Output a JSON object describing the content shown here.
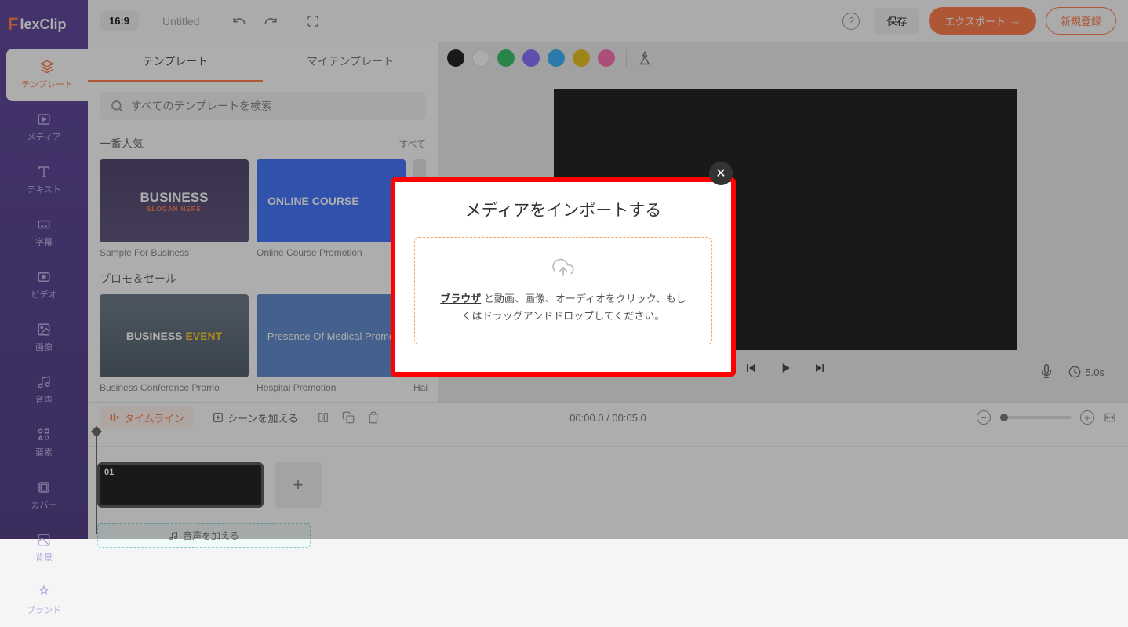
{
  "logo": "lexClip",
  "header": {
    "aspect": "16:9",
    "title": "Untitled",
    "save": "保存",
    "export": "エクスポート",
    "signup": "新規登録"
  },
  "sidebar": {
    "items": [
      {
        "label": "テンプレート"
      },
      {
        "label": "メディア"
      },
      {
        "label": "テキスト"
      },
      {
        "label": "字幕"
      },
      {
        "label": "ビデオ"
      },
      {
        "label": "画像"
      },
      {
        "label": "音声"
      },
      {
        "label": "要素"
      },
      {
        "label": "カバー"
      },
      {
        "label": "背景"
      },
      {
        "label": "ブランド"
      }
    ]
  },
  "panel": {
    "tabs": [
      "テンプレート",
      "マイテンプレート"
    ],
    "search_placeholder": "すべてのテンプレートを検索",
    "sections": [
      {
        "title": "一番人気",
        "all": "すべて",
        "templates": [
          {
            "label": "Sample For Business",
            "heading": "BUSINESS",
            "sub": "SLOGAN HERE"
          },
          {
            "label": "Online Course Promotion",
            "heading": "ONLINE COURSE",
            "sub": ""
          }
        ]
      },
      {
        "title": "プロモ＆セール",
        "all": "",
        "templates": [
          {
            "label": "Business Conference Promo",
            "heading": "BUSINESS EVENT",
            "sub": ""
          },
          {
            "label": "Hospital Promotion",
            "heading": "Presence Of Medical Promo",
            "sub": ""
          }
        ],
        "peek_label": "Hai"
      }
    ]
  },
  "canvas": {
    "colors": [
      "#000000",
      "#ffffff",
      "#1db954",
      "#7b5cff",
      "#1ea7fd",
      "#e6b800",
      "#ff5ca8"
    ],
    "duration": "5.0s"
  },
  "timeline": {
    "tab": "タイムライン",
    "add_scene": "シーンを加える",
    "time": "00:00.0 / 00:05.0",
    "clip_num": "01",
    "audio": "音声を加える"
  },
  "modal": {
    "title": "メディアをインポートする",
    "link": "ブラウザ",
    "text1": " と動画、画像、オーディオをクリック、もしくはドラッグアンドドロップしてください。"
  }
}
